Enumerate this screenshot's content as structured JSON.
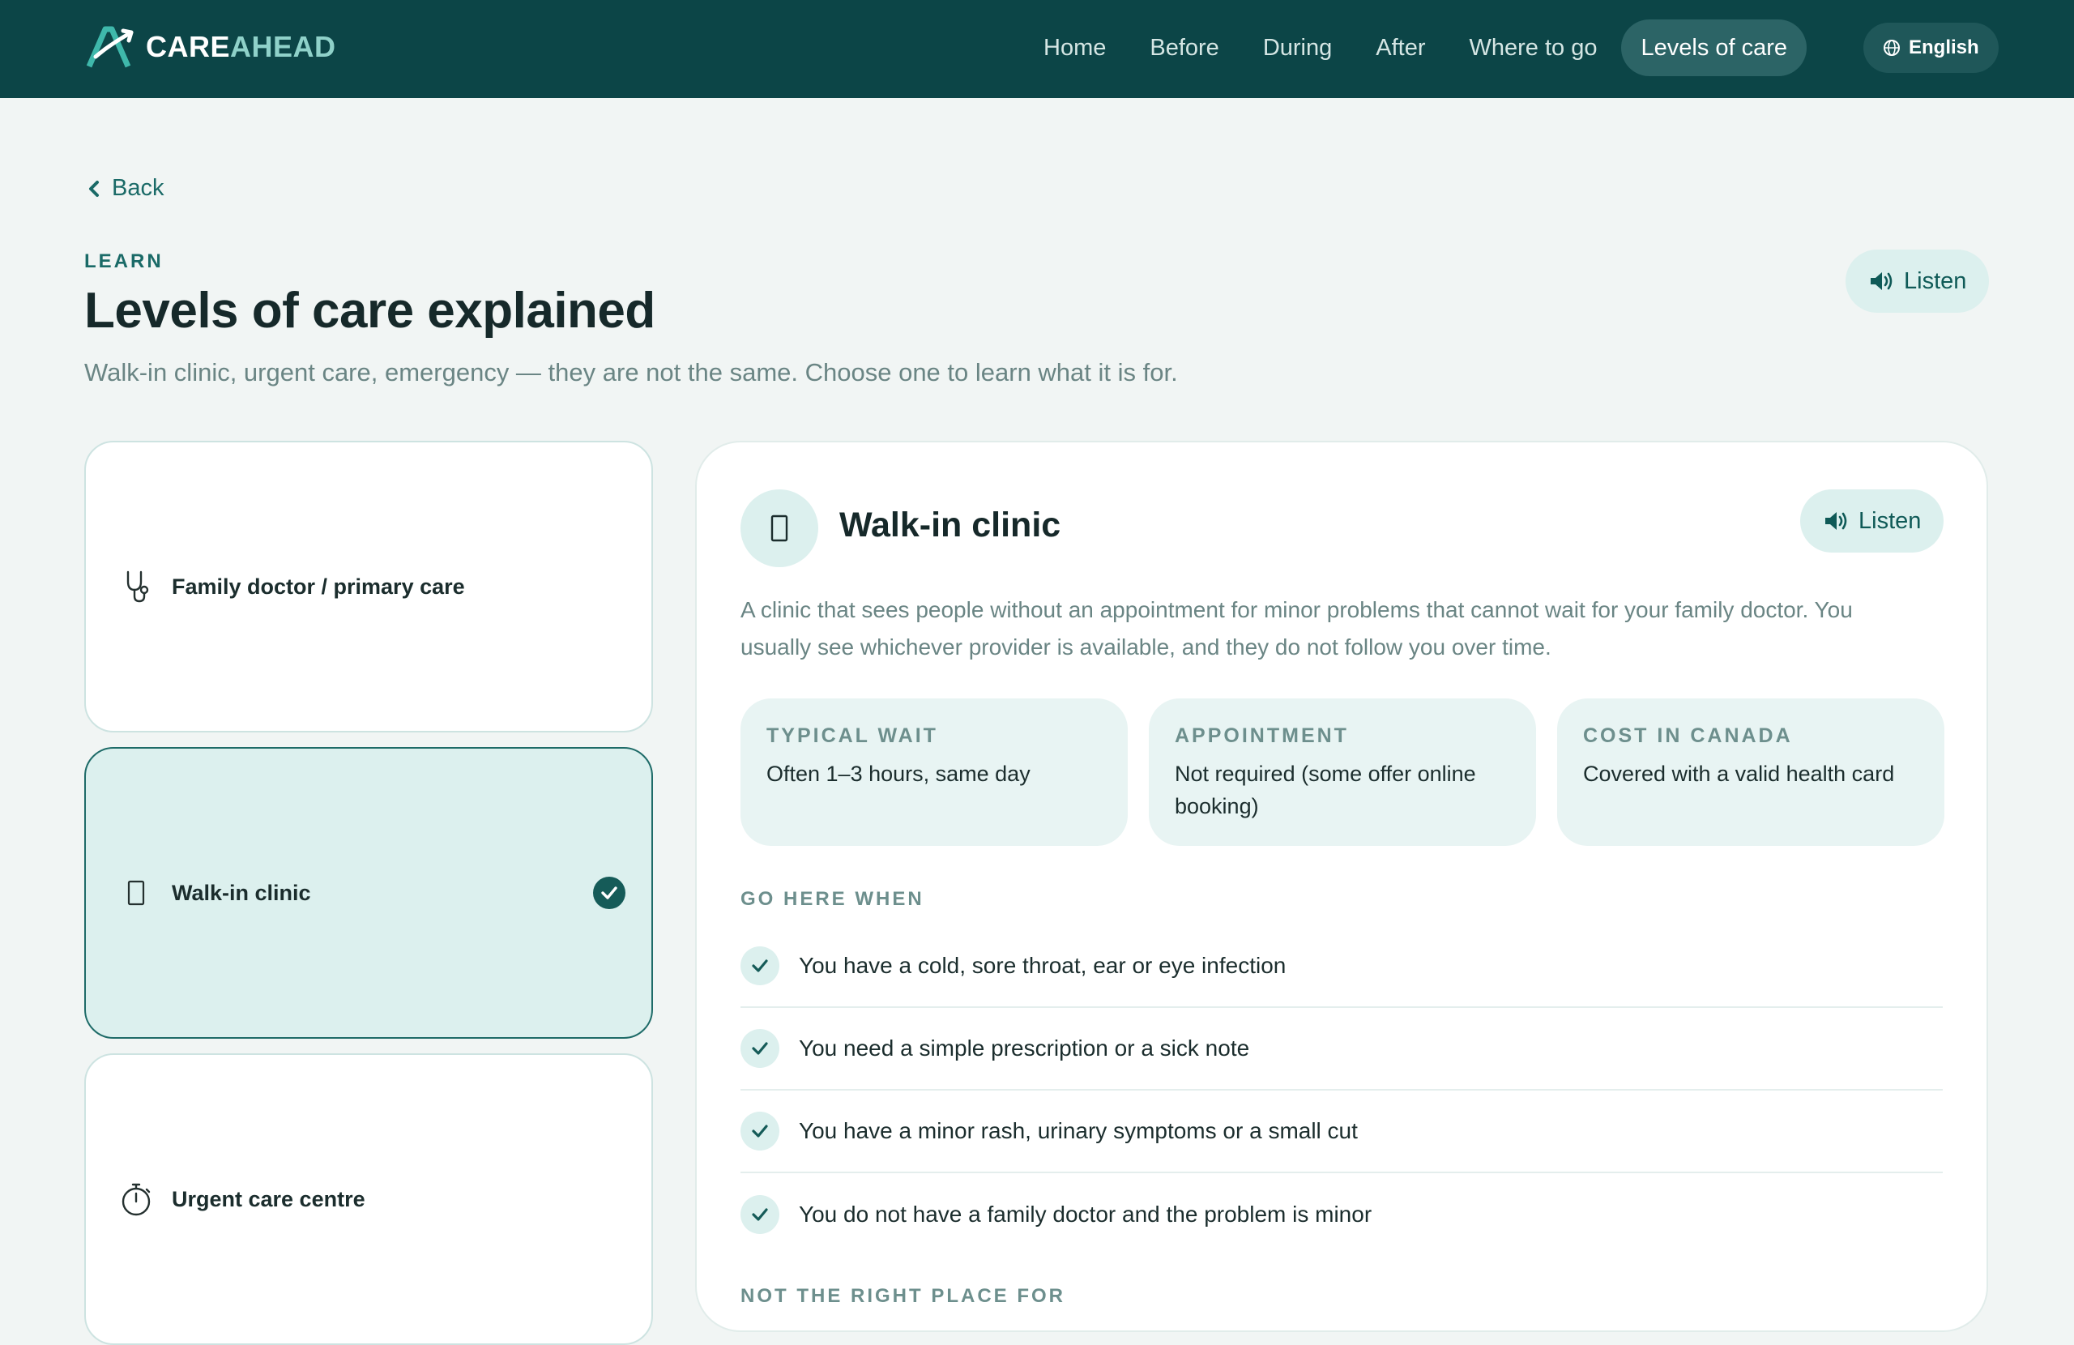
{
  "brand": {
    "name_part1": "CARE",
    "name_part2": "AHEAD"
  },
  "nav": {
    "items": [
      {
        "label": "Home"
      },
      {
        "label": "Before"
      },
      {
        "label": "During"
      },
      {
        "label": "After"
      },
      {
        "label": "Where to go"
      },
      {
        "label": "Levels of care",
        "active": true
      }
    ],
    "language": {
      "label": "English",
      "icon": "globe-icon"
    }
  },
  "page": {
    "back_label": "Back",
    "eyebrow": "LEARN",
    "title": "Levels of care explained",
    "subtitle": "Walk-in clinic, urgent care, emergency — they are not the same. Choose one to learn what it is for.",
    "listen_label": "Listen"
  },
  "options": [
    {
      "label": "Family doctor / primary care",
      "icon": "stethoscope-icon",
      "selected": false
    },
    {
      "label": "Walk-in clinic",
      "icon": "clinic-icon",
      "selected": true
    },
    {
      "label": "Urgent care centre",
      "icon": "stopwatch-icon",
      "selected": false
    }
  ],
  "detail": {
    "title": "Walk-in clinic",
    "icon": "clinic-icon",
    "listen_label": "Listen",
    "description": "A clinic that sees people without an appointment for minor problems that cannot wait for your family doctor. You usually see whichever provider is available, and they do not follow you over time.",
    "facts": [
      {
        "label": "TYPICAL WAIT",
        "value": "Often 1–3 hours, same day"
      },
      {
        "label": "APPOINTMENT",
        "value": "Not required (some offer online booking)"
      },
      {
        "label": "COST IN CANADA",
        "value": "Covered with a valid health card"
      }
    ],
    "go_here_heading": "GO HERE WHEN",
    "go_here_items": [
      "You have a cold, sore throat, ear or eye infection",
      "You need a simple prescription or a sick note",
      "You have a minor rash, urinary symptoms or a small cut",
      "You do not have a family doctor and the problem is minor"
    ],
    "not_here_heading": "NOT THE RIGHT PLACE FOR"
  },
  "colors": {
    "header_bg": "#0c4547",
    "accent": "#1a6a67",
    "selected_bg": "#dcf0ee",
    "page_bg": "#f1f5f4"
  }
}
